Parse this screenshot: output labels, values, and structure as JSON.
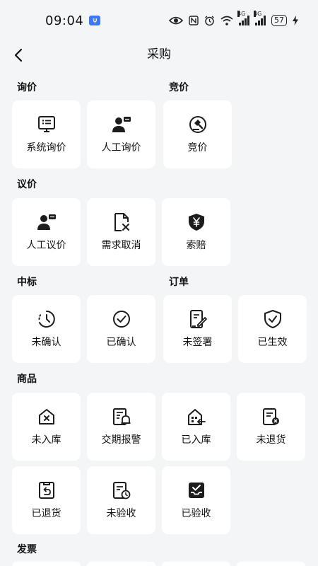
{
  "status": {
    "time": "09:04",
    "usb_icon": "usb-debug-icon",
    "network": "4G",
    "battery": "57"
  },
  "header": {
    "title": "采购",
    "back_icon": "chevron-left-icon"
  },
  "sections": {
    "inquiry": {
      "label": "询价",
      "items": [
        {
          "label": "系统询价",
          "icon": "monitor-list-icon"
        },
        {
          "label": "人工询价",
          "icon": "person-chat-icon"
        }
      ]
    },
    "bidding": {
      "label": "竞价",
      "items": [
        {
          "label": "竞价",
          "icon": "gavel-icon"
        }
      ]
    },
    "negotiation": {
      "label": "议价",
      "items": [
        {
          "label": "人工议价",
          "icon": "person-chat-icon"
        },
        {
          "label": "需求取消",
          "icon": "document-cancel-icon"
        },
        {
          "label": "索赔",
          "icon": "shield-yuan-icon"
        }
      ]
    },
    "award": {
      "label": "中标",
      "items": [
        {
          "label": "未确认",
          "icon": "clock-pending-icon"
        },
        {
          "label": "已确认",
          "icon": "check-circle-icon"
        }
      ]
    },
    "order": {
      "label": "订单",
      "items": [
        {
          "label": "未签署",
          "icon": "document-sign-icon"
        },
        {
          "label": "已生效",
          "icon": "shield-check-icon"
        }
      ]
    },
    "goods": {
      "label": "商品",
      "items": [
        {
          "label": "未入库",
          "icon": "house-x-icon"
        },
        {
          "label": "交期报警",
          "icon": "schedule-alarm-icon"
        },
        {
          "label": "已入库",
          "icon": "warehouse-in-icon"
        },
        {
          "label": "未退货",
          "icon": "document-x-icon"
        },
        {
          "label": "已退货",
          "icon": "return-box-icon"
        },
        {
          "label": "未验收",
          "icon": "document-clock-icon"
        },
        {
          "label": "已验收",
          "icon": "inbox-check-icon"
        }
      ]
    },
    "invoice": {
      "label": "发票"
    }
  }
}
